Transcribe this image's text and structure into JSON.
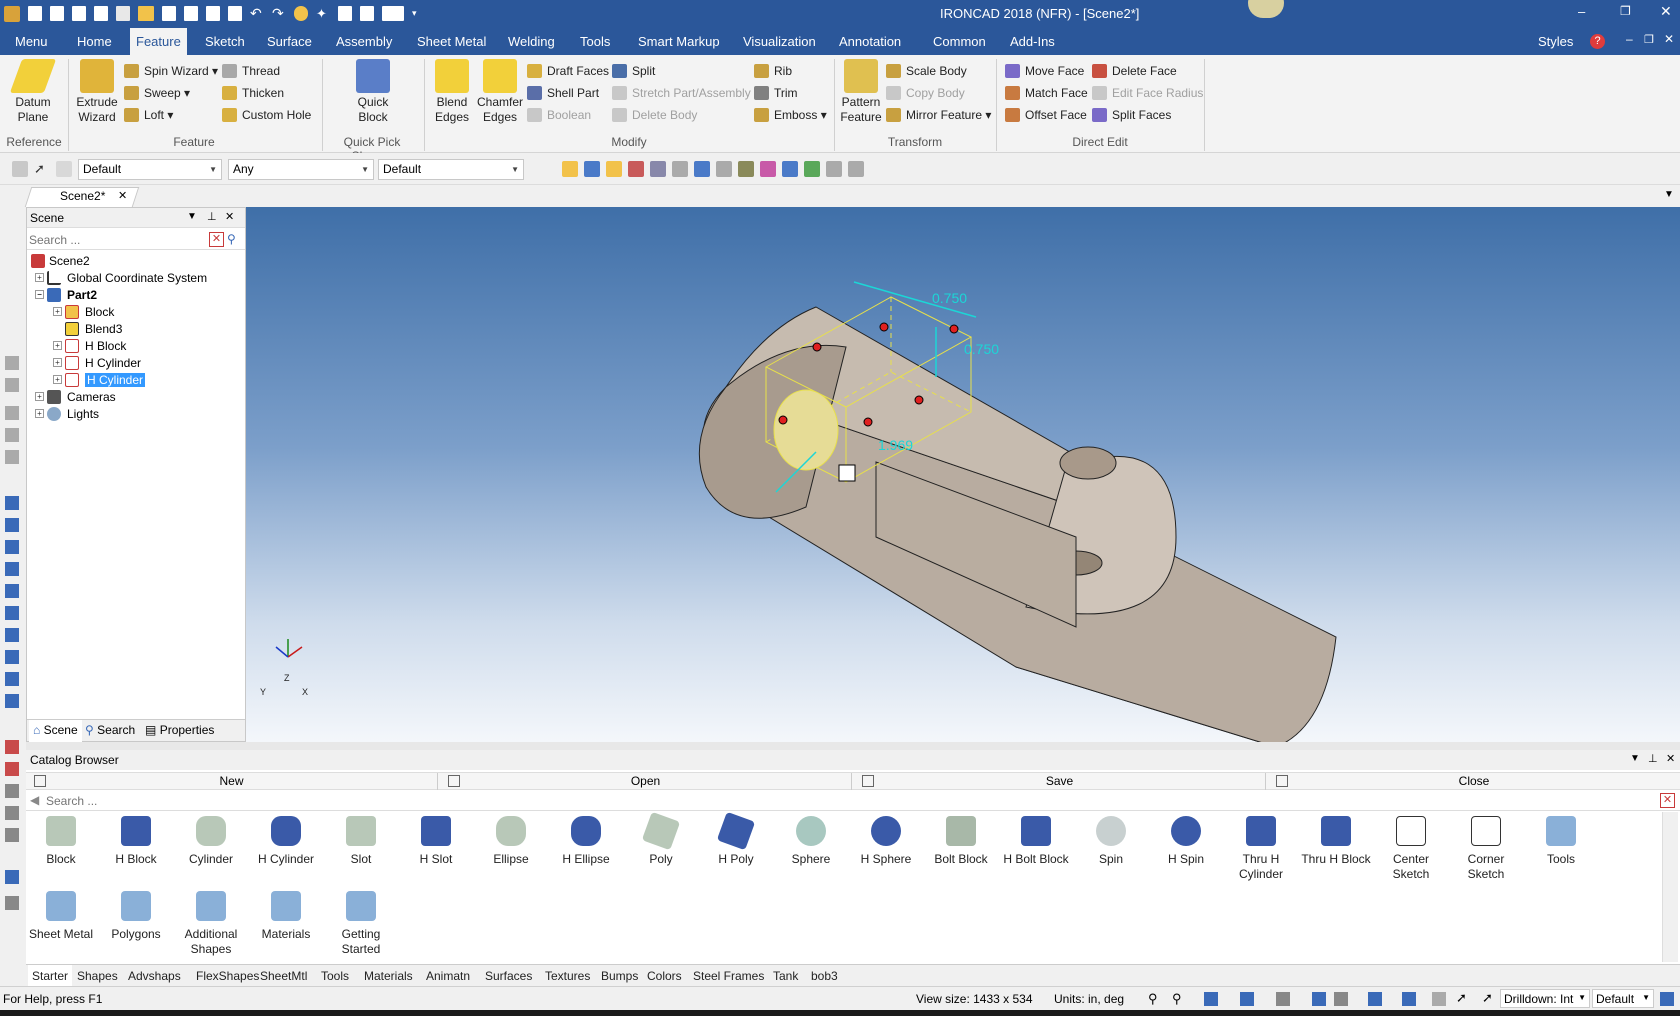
{
  "title_bar": {
    "title": "IRONCAD 2018 (NFR) - [Scene2*]"
  },
  "menu_tabs": [
    "Menu",
    "Home",
    "Feature",
    "Sketch",
    "Surface",
    "Assembly",
    "Sheet Metal",
    "Welding",
    "Tools",
    "Smart Markup",
    "Visualization",
    "Annotation",
    "Common",
    "Add-Ins"
  ],
  "menu_right": {
    "styles": "Styles"
  },
  "ribbon": {
    "reference": {
      "datum_plane": "Datum Plane",
      "label": "Reference"
    },
    "feature": {
      "extrude_wizard": "Extrude Wizard",
      "spin_wizard": "Spin Wizard",
      "sweep": "Sweep",
      "loft": "Loft",
      "thread": "Thread",
      "thicken": "Thicken",
      "custom_hole": "Custom Hole",
      "label": "Feature"
    },
    "quick_pick": {
      "quick_block": "Quick Block",
      "label": "Quick Pick Shapes"
    },
    "modify": {
      "blend_edges": "Blend Edges",
      "chamfer_edges": "Chamfer Edges",
      "draft_faces": "Draft Faces",
      "shell_part": "Shell Part",
      "boolean": "Boolean",
      "split": "Split",
      "stretch": "Stretch Part/Assembly",
      "delete_body": "Delete Body",
      "rib": "Rib",
      "trim": "Trim",
      "emboss": "Emboss",
      "label": "Modify"
    },
    "transform": {
      "pattern_feature": "Pattern Feature",
      "scale_body": "Scale Body",
      "copy_body": "Copy Body",
      "mirror_feature": "Mirror Feature",
      "label": "Transform"
    },
    "direct_edit": {
      "move_face": "Move Face",
      "match_face": "Match Face",
      "offset_face": "Offset Face",
      "delete_face": "Delete Face",
      "edit_face_radius": "Edit Face Radius",
      "split_faces": "Split Faces",
      "label": "Direct Edit"
    }
  },
  "toolbar2": {
    "combo1": "Default",
    "combo2": "Any",
    "combo3": "Default"
  },
  "doc_tab": {
    "label": "Scene2*"
  },
  "scene_panel": {
    "title": "Scene",
    "search_placeholder": "Search ...",
    "tree": [
      {
        "label": "Scene2"
      },
      {
        "label": "Global Coordinate System"
      },
      {
        "label": "Part2"
      },
      {
        "label": "Block"
      },
      {
        "label": "Blend3"
      },
      {
        "label": "H Block"
      },
      {
        "label": "H Cylinder"
      },
      {
        "label": "H Cylinder"
      },
      {
        "label": "Cameras"
      },
      {
        "label": "Lights"
      }
    ],
    "bottom_tabs": [
      "Scene",
      "Search",
      "Properties"
    ]
  },
  "viewport": {
    "dim1": "0.750",
    "dim2": "0.750",
    "dim3": "1.969",
    "axis_z": "Z",
    "axis_y": "Y",
    "axis_x": "X"
  },
  "catalog": {
    "title": "Catalog Browser",
    "actions": [
      "New",
      "Open",
      "Save",
      "Close"
    ],
    "search_placeholder": "Search ...",
    "items_row1": [
      "Block",
      "H Block",
      "Cylinder",
      "H Cylinder",
      "Slot",
      "H Slot",
      "Ellipse",
      "H Ellipse",
      "Poly",
      "H Poly",
      "Sphere",
      "H Sphere",
      "Bolt Block",
      "H Bolt Block",
      "Spin",
      "H Spin",
      "Thru H Cylinder",
      "Thru H Block",
      "Center Sketch",
      "Corner Sketch",
      "Tools"
    ],
    "items_row2": [
      "Sheet Metal",
      "Polygons",
      "Additional Shapes",
      "Materials",
      "Getting Started"
    ],
    "tabs": [
      "Starter",
      "Shapes",
      "Advshaps",
      "FlexShapes",
      "SheetMtl",
      "Tools",
      "Materials",
      "Animatn",
      "Surfaces",
      "Textures",
      "Bumps",
      "Colors",
      "Steel Frames",
      "Tank",
      "bob3"
    ]
  },
  "status_bar": {
    "help": "For Help, press F1",
    "view_size": "View size: 1433 x  534",
    "units": "Units: in, deg",
    "drilldown": "Drilldown: Int",
    "default": "Default"
  }
}
